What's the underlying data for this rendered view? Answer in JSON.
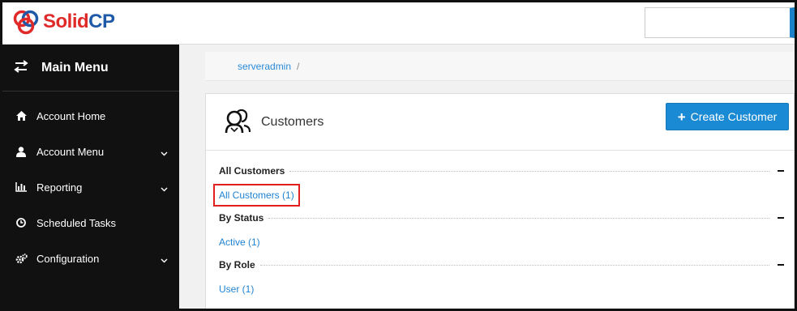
{
  "brand": {
    "logo_solid": "Solid",
    "logo_cp": "CP",
    "logo_red": "#e02a2a",
    "logo_blue": "#1f5aa8"
  },
  "search": {
    "placeholder": ""
  },
  "sidebar": {
    "title": "Main Menu",
    "items": [
      {
        "label": "Account Home",
        "icon": "home-icon",
        "has_submenu": false
      },
      {
        "label": "Account Menu",
        "icon": "user-icon",
        "has_submenu": true
      },
      {
        "label": "Reporting",
        "icon": "bar-chart-icon",
        "has_submenu": true
      },
      {
        "label": "Scheduled Tasks",
        "icon": "clock-icon",
        "has_submenu": false
      },
      {
        "label": "Configuration",
        "icon": "gears-icon",
        "has_submenu": true
      }
    ]
  },
  "breadcrumb": {
    "items": [
      "serveradmin"
    ],
    "separator": "/"
  },
  "panel": {
    "title": "Customers",
    "create_button": {
      "label": "Create Customer"
    },
    "groups": [
      {
        "heading": "All Customers",
        "links": [
          "All Customers (1)"
        ]
      },
      {
        "heading": "By Status",
        "links": [
          "Active (1)"
        ]
      },
      {
        "heading": "By Role",
        "links": [
          "User (1)"
        ]
      }
    ]
  },
  "colors": {
    "accent": "#1b8ad4",
    "link": "#1f82d2",
    "sidebar_bg": "#111111",
    "highlight": "#e21f1f"
  }
}
